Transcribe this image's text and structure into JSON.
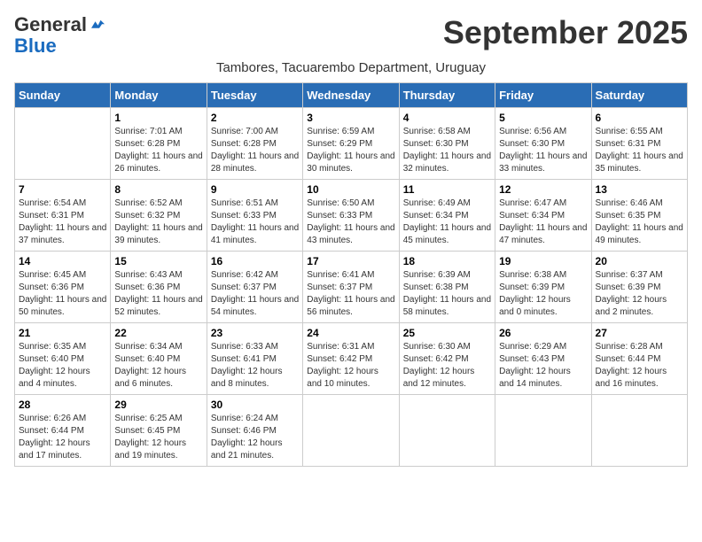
{
  "header": {
    "logo_general": "General",
    "logo_blue": "Blue",
    "month_title": "September 2025",
    "subtitle": "Tambores, Tacuarembo Department, Uruguay"
  },
  "days_of_week": [
    "Sunday",
    "Monday",
    "Tuesday",
    "Wednesday",
    "Thursday",
    "Friday",
    "Saturday"
  ],
  "weeks": [
    [
      {
        "day": "",
        "sunrise": "",
        "sunset": "",
        "daylight": ""
      },
      {
        "day": "1",
        "sunrise": "7:01 AM",
        "sunset": "6:28 PM",
        "daylight": "11 hours and 26 minutes."
      },
      {
        "day": "2",
        "sunrise": "7:00 AM",
        "sunset": "6:28 PM",
        "daylight": "11 hours and 28 minutes."
      },
      {
        "day": "3",
        "sunrise": "6:59 AM",
        "sunset": "6:29 PM",
        "daylight": "11 hours and 30 minutes."
      },
      {
        "day": "4",
        "sunrise": "6:58 AM",
        "sunset": "6:30 PM",
        "daylight": "11 hours and 32 minutes."
      },
      {
        "day": "5",
        "sunrise": "6:56 AM",
        "sunset": "6:30 PM",
        "daylight": "11 hours and 33 minutes."
      },
      {
        "day": "6",
        "sunrise": "6:55 AM",
        "sunset": "6:31 PM",
        "daylight": "11 hours and 35 minutes."
      }
    ],
    [
      {
        "day": "7",
        "sunrise": "6:54 AM",
        "sunset": "6:31 PM",
        "daylight": "11 hours and 37 minutes."
      },
      {
        "day": "8",
        "sunrise": "6:52 AM",
        "sunset": "6:32 PM",
        "daylight": "11 hours and 39 minutes."
      },
      {
        "day": "9",
        "sunrise": "6:51 AM",
        "sunset": "6:33 PM",
        "daylight": "11 hours and 41 minutes."
      },
      {
        "day": "10",
        "sunrise": "6:50 AM",
        "sunset": "6:33 PM",
        "daylight": "11 hours and 43 minutes."
      },
      {
        "day": "11",
        "sunrise": "6:49 AM",
        "sunset": "6:34 PM",
        "daylight": "11 hours and 45 minutes."
      },
      {
        "day": "12",
        "sunrise": "6:47 AM",
        "sunset": "6:34 PM",
        "daylight": "11 hours and 47 minutes."
      },
      {
        "day": "13",
        "sunrise": "6:46 AM",
        "sunset": "6:35 PM",
        "daylight": "11 hours and 49 minutes."
      }
    ],
    [
      {
        "day": "14",
        "sunrise": "6:45 AM",
        "sunset": "6:36 PM",
        "daylight": "11 hours and 50 minutes."
      },
      {
        "day": "15",
        "sunrise": "6:43 AM",
        "sunset": "6:36 PM",
        "daylight": "11 hours and 52 minutes."
      },
      {
        "day": "16",
        "sunrise": "6:42 AM",
        "sunset": "6:37 PM",
        "daylight": "11 hours and 54 minutes."
      },
      {
        "day": "17",
        "sunrise": "6:41 AM",
        "sunset": "6:37 PM",
        "daylight": "11 hours and 56 minutes."
      },
      {
        "day": "18",
        "sunrise": "6:39 AM",
        "sunset": "6:38 PM",
        "daylight": "11 hours and 58 minutes."
      },
      {
        "day": "19",
        "sunrise": "6:38 AM",
        "sunset": "6:39 PM",
        "daylight": "12 hours and 0 minutes."
      },
      {
        "day": "20",
        "sunrise": "6:37 AM",
        "sunset": "6:39 PM",
        "daylight": "12 hours and 2 minutes."
      }
    ],
    [
      {
        "day": "21",
        "sunrise": "6:35 AM",
        "sunset": "6:40 PM",
        "daylight": "12 hours and 4 minutes."
      },
      {
        "day": "22",
        "sunrise": "6:34 AM",
        "sunset": "6:40 PM",
        "daylight": "12 hours and 6 minutes."
      },
      {
        "day": "23",
        "sunrise": "6:33 AM",
        "sunset": "6:41 PM",
        "daylight": "12 hours and 8 minutes."
      },
      {
        "day": "24",
        "sunrise": "6:31 AM",
        "sunset": "6:42 PM",
        "daylight": "12 hours and 10 minutes."
      },
      {
        "day": "25",
        "sunrise": "6:30 AM",
        "sunset": "6:42 PM",
        "daylight": "12 hours and 12 minutes."
      },
      {
        "day": "26",
        "sunrise": "6:29 AM",
        "sunset": "6:43 PM",
        "daylight": "12 hours and 14 minutes."
      },
      {
        "day": "27",
        "sunrise": "6:28 AM",
        "sunset": "6:44 PM",
        "daylight": "12 hours and 16 minutes."
      }
    ],
    [
      {
        "day": "28",
        "sunrise": "6:26 AM",
        "sunset": "6:44 PM",
        "daylight": "12 hours and 17 minutes."
      },
      {
        "day": "29",
        "sunrise": "6:25 AM",
        "sunset": "6:45 PM",
        "daylight": "12 hours and 19 minutes."
      },
      {
        "day": "30",
        "sunrise": "6:24 AM",
        "sunset": "6:46 PM",
        "daylight": "12 hours and 21 minutes."
      },
      {
        "day": "",
        "sunrise": "",
        "sunset": "",
        "daylight": ""
      },
      {
        "day": "",
        "sunrise": "",
        "sunset": "",
        "daylight": ""
      },
      {
        "day": "",
        "sunrise": "",
        "sunset": "",
        "daylight": ""
      },
      {
        "day": "",
        "sunrise": "",
        "sunset": "",
        "daylight": ""
      }
    ]
  ],
  "labels": {
    "sunrise_label": "Sunrise:",
    "sunset_label": "Sunset:",
    "daylight_label": "Daylight:"
  }
}
